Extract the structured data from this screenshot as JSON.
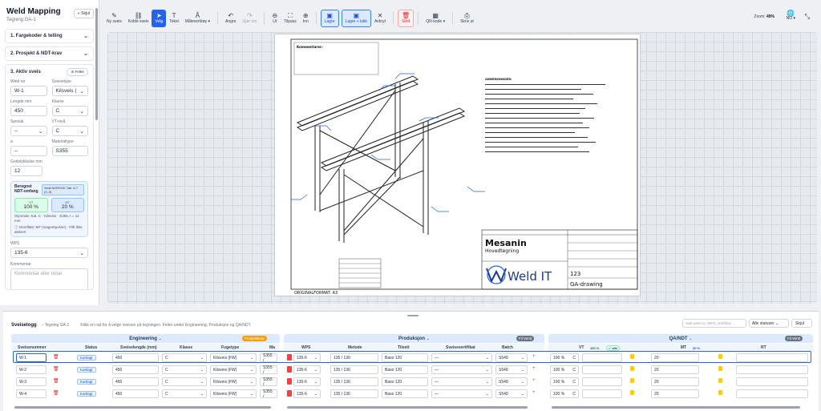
{
  "app": {
    "title": "Weld Mapping",
    "subtitle": "Tegning GA-1",
    "hide_label": "« Skjul"
  },
  "sidebar": {
    "sections": [
      {
        "label": "1. Fargekoder & telling"
      },
      {
        "label": "2. Prosjekt & NDT-krav"
      }
    ],
    "active": {
      "title": "3. Aktiv sveis",
      "filter_label": "⊘ Felter",
      "fields": {
        "weld_no_label": "Weld no",
        "weld_no": "W-1",
        "sveisetype_label": "Sveisetype",
        "sveisetype": "Kilsveis (",
        "lengde_label": "Lengde mm",
        "lengde": "450",
        "klasse_label": "Klasse",
        "klasse": "C",
        "spesial_label": "Spesial",
        "spesial": "–",
        "vtniva_label": "VT-nivå",
        "vtniva": "C",
        "a_label": "a",
        "a": "–",
        "material_label": "Materialtype",
        "material": "S355",
        "godstykkelse_label": "Godstykkelse mm",
        "godstykkelse": "12"
      },
      "ndt": {
        "title": "Beregnet NDT-omfang",
        "badge": "Nivå NORSOK Tab. 8.7 (C-0)",
        "vt_label": "VT",
        "vt_value": "100 %",
        "mt_label": "MT",
        "mt_value": "20 %",
        "styrende": "Styrende: Kat. C · Kilsveis · S355, t = 12 mm",
        "note": "ⓘ Overflate: MT (magnetpulver) · Fillt ikke aktivert"
      },
      "wps_label": "WPS",
      "wps": "135-6",
      "comment_label": "Kommentar",
      "comment_placeholder": "Kommentar eller notat"
    }
  },
  "toolbar": {
    "buttons": [
      {
        "label": "Ny sveis",
        "icon": "✎"
      },
      {
        "label": "Koble sveis",
        "icon": "⛓"
      },
      {
        "label": "Velg",
        "icon": "➤"
      },
      {
        "label": "Tekst",
        "icon": "T"
      },
      {
        "label": "Måleverktøy ▾",
        "icon": "Å"
      },
      {
        "label": "Angre",
        "icon": "↶"
      },
      {
        "label": "Gjør om",
        "icon": "↷"
      },
      {
        "label": "Ut",
        "icon": "⊖"
      },
      {
        "label": "Tilpass",
        "icon": "⛶"
      },
      {
        "label": "Inn",
        "icon": "⊕"
      },
      {
        "label": "Lagre",
        "icon": "▣"
      },
      {
        "label": "Lagre + lukk",
        "icon": "▣"
      },
      {
        "label": "Avbryt",
        "icon": "✕"
      },
      {
        "label": "Slett",
        "icon": "🗑"
      },
      {
        "label": "QR-kode ▾",
        "icon": "▦"
      },
      {
        "label": "Skriv ut",
        "icon": "⎙"
      }
    ],
    "zoom_label": "Zoom:",
    "zoom_value": "49%",
    "lang": "NO ▾"
  },
  "drawing": {
    "company": "Weld IT",
    "title_main": "Mesanin",
    "title_sub": "Hovedtegning",
    "drawing_no": "123",
    "drawing_name": "GA-drawing",
    "format": "ORIGINALFORMAT: A3",
    "comment_title": "Kommentarer:",
    "notes_title": "ANMERKNINGER:"
  },
  "log": {
    "title": "Sveiselogg",
    "drawing": "– Tegning GA-1",
    "hint": "Klikk en rad for å velge sveisen på tegningen. Felter under Engineering, Produksjon og QA/NDT.",
    "search_placeholder": "Søk weld no, WPS, sertifikat …",
    "status_filter": "Alle statuser",
    "hide_label": "Skjul",
    "groups": {
      "engineering": "Engineering",
      "produksjon": "Produksjon",
      "qa": "QA/NDT"
    },
    "eng_chip": "Prosjektkrav",
    "prod_chip": "Fil Ventl",
    "qa_chip": "Fil Ventl",
    "columns": {
      "nr": "Sveisenummer",
      "status": "Status",
      "lengde": "Sveiselengde (mm)",
      "klasse": "Klasse",
      "fugetype": "Fugetype",
      "mat": "Ma",
      "wps": "WPS",
      "metode": "Metode",
      "tilsett": "Tilsett",
      "sert": "Sveisesertifikat",
      "batch": "Batch",
      "vt": "VT",
      "vt_pct": "100 %",
      "vt_ok": "✓ alle",
      "mt": "MT",
      "mt_pct": "20 %",
      "rt": "RT"
    },
    "rows": [
      {
        "nr": "W-1",
        "status": "Kartlagt",
        "lengde": "450",
        "klasse": "C",
        "fugetype": "Kilsveis (FW)",
        "mat": "S355 /",
        "wps": "135-6",
        "metode": "135 / 136",
        "tilsett": "Baso 120",
        "sert": "—",
        "batch": "S549",
        "vt": "100 %",
        "vtc": "C",
        "mt": "20"
      },
      {
        "nr": "W-2",
        "status": "Kartlagt",
        "lengde": "450",
        "klasse": "C",
        "fugetype": "Kilsveis (FW)",
        "mat": "S355 /",
        "wps": "135-6",
        "metode": "135 / 136",
        "tilsett": "Baso 120",
        "sert": "—",
        "batch": "S549",
        "vt": "100 %",
        "vtc": "C",
        "mt": "20"
      },
      {
        "nr": "W-3",
        "status": "Kartlagt",
        "lengde": "450",
        "klasse": "C",
        "fugetype": "Kilsveis (FW)",
        "mat": "S355 /",
        "wps": "135-6",
        "metode": "135 / 136",
        "tilsett": "Baso 120",
        "sert": "—",
        "batch": "S549",
        "vt": "100 %",
        "vtc": "C",
        "mt": "20"
      },
      {
        "nr": "W-4",
        "status": "Kartlagt",
        "lengde": "450",
        "klasse": "C",
        "fugetype": "Kilsveis (FW)",
        "mat": "S355 /",
        "wps": "135-6",
        "metode": "135 / 136",
        "tilsett": "Baso 120",
        "sert": "—",
        "batch": "S549",
        "vt": "100 %",
        "vtc": "C",
        "mt": "20"
      }
    ]
  },
  "colors": {
    "accent": "#2563eb",
    "danger": "#dc2626",
    "warn": "#f59e0b"
  }
}
